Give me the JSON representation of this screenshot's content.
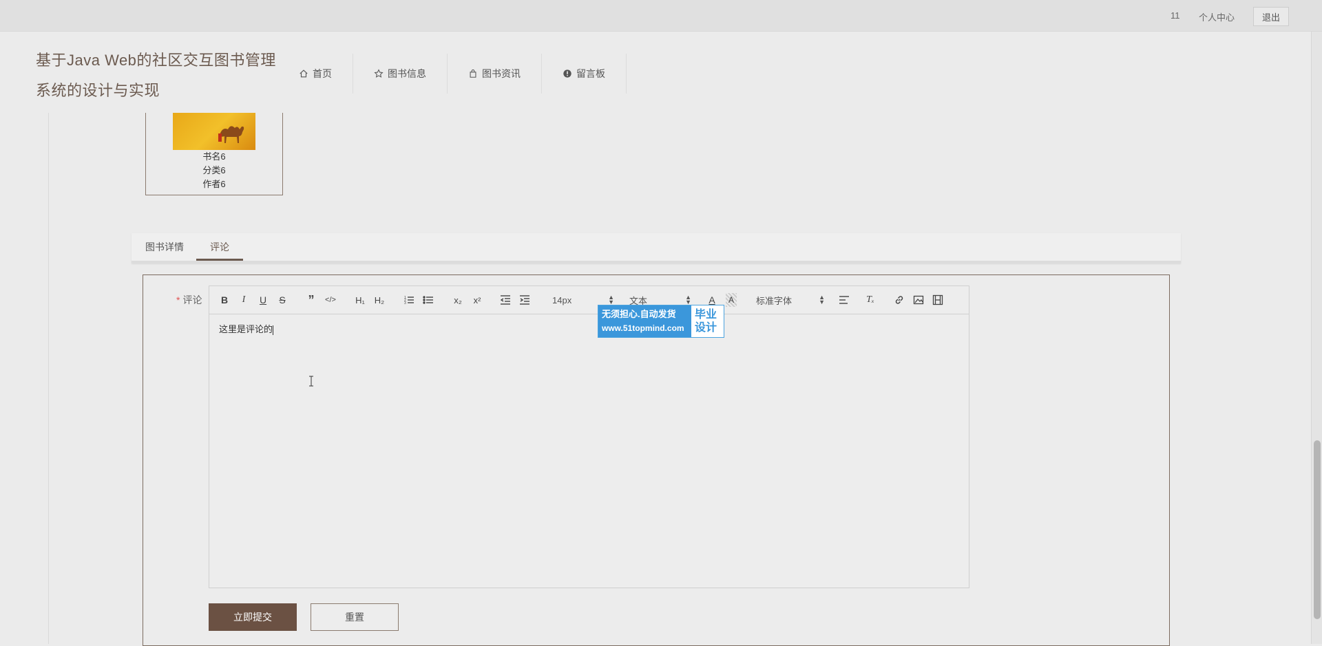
{
  "topbar": {
    "user_id": "11",
    "personal_center": "个人中心",
    "logout": "退出"
  },
  "header": {
    "title": "基于Java Web的社区交互图书管理系统的设计与实现",
    "nav": [
      {
        "label": "首页",
        "icon": "home-icon"
      },
      {
        "label": "图书信息",
        "icon": "star-icon"
      },
      {
        "label": "图书资讯",
        "icon": "bag-icon"
      },
      {
        "label": "留言板",
        "icon": "alert-icon"
      }
    ]
  },
  "book": {
    "name": "书名6",
    "category": "分类6",
    "author": "作者6"
  },
  "tabs": [
    {
      "label": "图书详情",
      "active": false
    },
    {
      "label": "评论",
      "active": true
    }
  ],
  "form": {
    "comment_label": "评论",
    "required_mark": "*",
    "editor_text": "这里是评论的",
    "font_size": "14px",
    "format": "文本",
    "font_family": "标准字体",
    "submit": "立即提交",
    "reset": "重置"
  },
  "watermark": {
    "line1": "无须担心.自动发货",
    "line2": "www.51topmind.com",
    "right1": "毕业",
    "right2": "设计"
  },
  "colors": {
    "accent": "#6b5143",
    "watermark_blue": "#3b97db",
    "required": "#e05252"
  }
}
